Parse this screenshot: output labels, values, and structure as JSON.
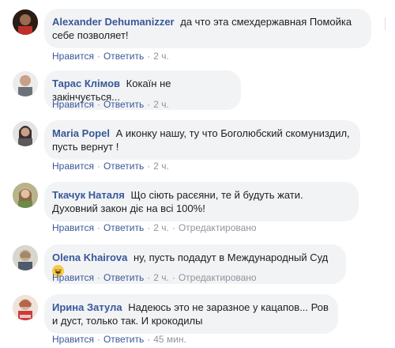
{
  "action_labels": {
    "like": "Нравится",
    "reply": "Ответить",
    "edited": "Отредактировано"
  },
  "comments": [
    {
      "author": "Alexander Dehumanizzer",
      "text": "да что эта смехдержавная Помойка себе позволяет!",
      "time": "2 ч."
    },
    {
      "author": "Тарас Клімов",
      "text": "Кокаїн не закінчується...",
      "time": "2 ч."
    },
    {
      "author": "Maria Popel",
      "text": "А иконку нашу, ту что Боголюбский скомуниздил, пусть вернут !",
      "time": "2 ч."
    },
    {
      "author": "Ткачук Наталя",
      "text": "Що сіють расєяни, те й будуть жати. Духовний закон діє на всі 100%!",
      "time": "2 ч."
    },
    {
      "author": "Olena Khairova",
      "text": "ну, пусть подадут в Международный Суд",
      "time": "2 ч."
    },
    {
      "author": "Ирина Затула",
      "text": "Надеюсь это не заразное у кацапов... Ров и дуст, только так. И крокодилы",
      "time": "45 мин."
    }
  ]
}
